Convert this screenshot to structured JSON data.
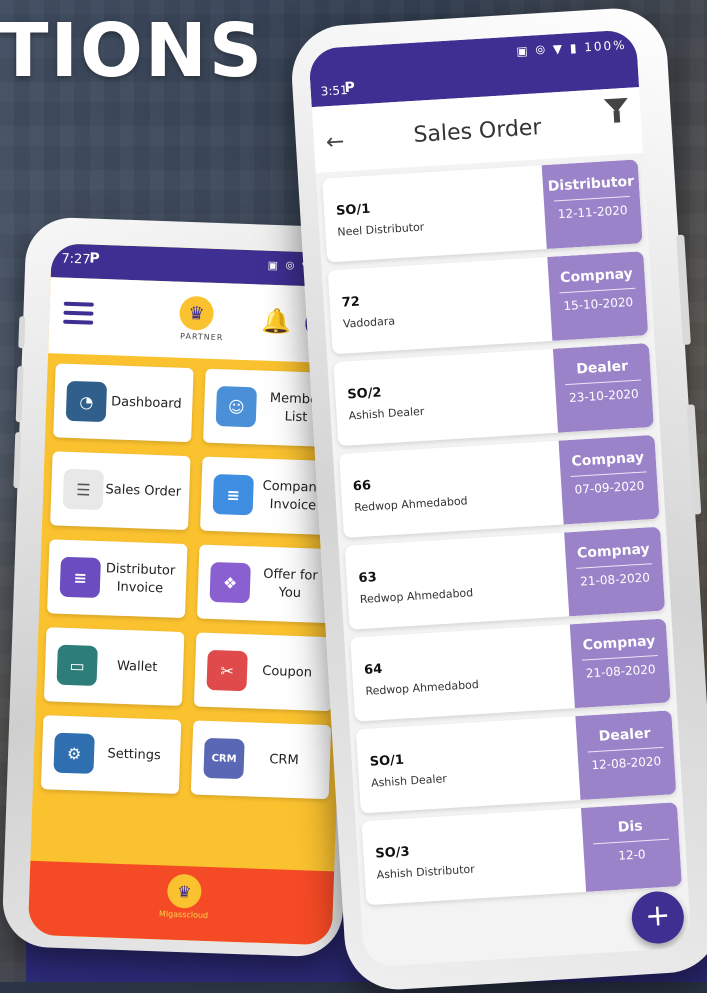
{
  "banner": {
    "title": "TIONS"
  },
  "left_phone": {
    "status": {
      "time": "7:27",
      "p": "P",
      "icons": "▣ ⦾ ▼ ▮ 10"
    },
    "brand": {
      "logo_text": "PARTNER"
    },
    "tiles": [
      {
        "label": "Dashboard",
        "icon": "gauge-icon",
        "color": "#2f5f8a"
      },
      {
        "label": "Member List",
        "icon": "user-icon",
        "color": "#4a90d9"
      },
      {
        "label": "Sales Order",
        "icon": "document-list-icon",
        "color": "#e8e8e8"
      },
      {
        "label": "Company Invoice",
        "icon": "invoice-doc-icon",
        "color": "#3f8ee2"
      },
      {
        "label": "Distributor Invoice",
        "icon": "invoice-doc-icon",
        "color": "#6b4dc0"
      },
      {
        "label": "Offer for You",
        "icon": "gift-icon",
        "color": "#8a5fd0"
      },
      {
        "label": "Wallet",
        "icon": "wallet-icon",
        "color": "#2d7d7a"
      },
      {
        "label": "Coupon",
        "icon": "coupon-icon",
        "color": "#e04a4a"
      },
      {
        "label": "Settings",
        "icon": "gear-icon",
        "color": "#2f6fb0"
      },
      {
        "label": "CRM",
        "icon": "crm-icon",
        "color": "#5a67b5"
      }
    ],
    "footer": {
      "brand": "Mlgasscloud"
    }
  },
  "right_phone": {
    "status": {
      "time": "3:51",
      "p": "P",
      "icons": "▣ ⦾ ▼ ▮ 100%"
    },
    "header": {
      "title": "Sales Order"
    },
    "orders": [
      {
        "number": "SO/1",
        "name": "Neel Distributor",
        "type": "Distributor",
        "date": "12-11-2020"
      },
      {
        "number": "72",
        "name": "Vadodara",
        "type": "Compnay",
        "date": "15-10-2020"
      },
      {
        "number": "SO/2",
        "name": "Ashish Dealer",
        "type": "Dealer",
        "date": "23-10-2020"
      },
      {
        "number": "66",
        "name": "Redwop Ahmedabod",
        "type": "Compnay",
        "date": "07-09-2020"
      },
      {
        "number": "63",
        "name": "Redwop Ahmedabod",
        "type": "Compnay",
        "date": "21-08-2020"
      },
      {
        "number": "64",
        "name": "Redwop Ahmedabod",
        "type": "Compnay",
        "date": "21-08-2020"
      },
      {
        "number": "SO/1",
        "name": "Ashish Dealer",
        "type": "Dealer",
        "date": "12-08-2020"
      },
      {
        "number": "SO/3",
        "name": "Ashish Distributor",
        "type": "Dis",
        "date": "12-0"
      }
    ],
    "fab_label": "+"
  }
}
